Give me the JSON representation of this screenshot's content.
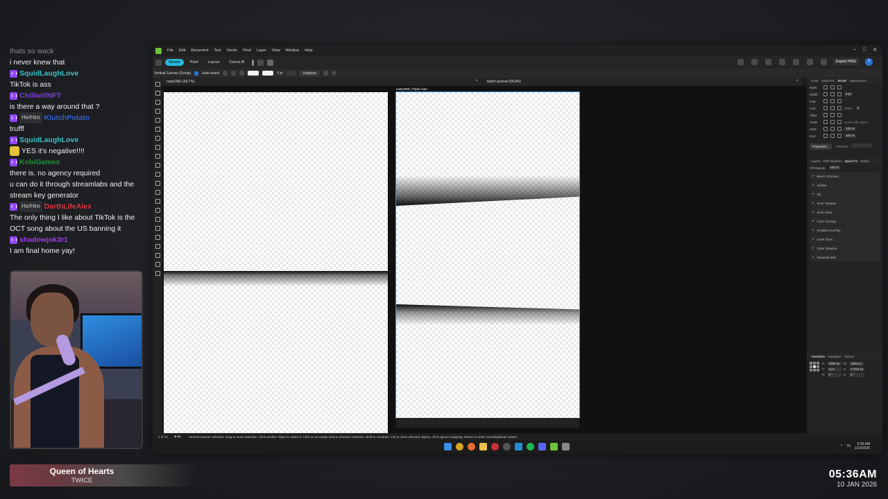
{
  "chat": {
    "messages": [
      {
        "type": "text",
        "text": "thats so wack",
        "faded": true
      },
      {
        "type": "text",
        "text": "i never knew that"
      },
      {
        "type": "user",
        "name": "SquidLaughLove",
        "color": "#3fc1c9"
      },
      {
        "type": "text",
        "text": "TikTok is ass"
      },
      {
        "type": "user",
        "name": "ChillwillNFT",
        "color": "#7b3fd6"
      },
      {
        "type": "text",
        "text": "is there a way around that ?"
      },
      {
        "type": "user",
        "pronoun": "He/Him",
        "name": "KlutchPotato",
        "color": "#2f64d6"
      },
      {
        "type": "text",
        "text": "trufff"
      },
      {
        "type": "user",
        "name": "SquidLaughLove",
        "color": "#3fc1c9"
      },
      {
        "type": "text",
        "text": "YES it's negative!!!!",
        "emote": true
      },
      {
        "type": "user",
        "name": "KobiGames",
        "color": "#2a8a3a"
      },
      {
        "type": "text",
        "text": "there is. no agency required"
      },
      {
        "type": "text",
        "text": "u can do it through streamlabs and the stream key generator"
      },
      {
        "type": "user",
        "pronoun": "He/Him",
        "name": "DarthLifeAlex",
        "color": "#e0333b"
      },
      {
        "type": "text",
        "text": "The only thing I like about TikTok is the OCT song about the US banning it"
      },
      {
        "type": "user",
        "name": "shadowjok3r1",
        "color": "#9b3fe6"
      },
      {
        "type": "text",
        "text": "I am final home yay!"
      }
    ]
  },
  "now_playing": {
    "title": "Queen of Hearts",
    "artist": "TWICE"
  },
  "clock": {
    "time": "05:36AM",
    "date": "10 JAN 2026"
  },
  "app": {
    "menu": [
      "File",
      "Edit",
      "Document",
      "Text",
      "Vector",
      "Pixel",
      "Layer",
      "View",
      "Window",
      "Help"
    ],
    "personas": [
      {
        "label": "Vector",
        "active": true
      },
      {
        "label": "Pixel",
        "active": false
      },
      {
        "label": "Layout",
        "active": false
      },
      {
        "label": "Canva AI",
        "active": false
      }
    ],
    "export_label": "Export PNG",
    "help_label": "?",
    "context": {
      "selection": "Vertical Canvas (Group)",
      "auto_select": "Auto-select",
      "stroke_value": "0 pt",
      "ungroup": "Ungroup"
    },
    "tabs": [
      {
        "label": "nuttyONE (59.7%)"
      },
      {
        "label": "twitch-portrait (58.8%)"
      }
    ],
    "artboard_label": "nuttyONE | Triple Cam",
    "status": {
      "page": "1 of 15",
      "hint": "'Vertical Canvas' selected. Drag to move selection. Click another object to select it. Click on an empty area to deselect selection. Shift to constrain. Ctrl to clone selected objects. Alt to ignore snapping. Return to enter move/duplicate values."
    },
    "tray": {
      "temp": "70",
      "time": "5:36 AM",
      "date": "1/10/2026"
    },
    "panel": {
      "top_tabs": [
        "Color",
        "Swatches",
        "Stroke",
        "Appearance"
      ],
      "active_top_tab": "Stroke",
      "stroke_rows": [
        {
          "label": "Style:"
        },
        {
          "label": "Width:",
          "value": "0 pt"
        },
        {
          "label": "Cap:"
        },
        {
          "label": "Join:",
          "extra": "Mitter:",
          "extra_value": "2"
        },
        {
          "label": "Align:"
        },
        {
          "label": "Order:",
          "extra": "Scale with object"
        },
        {
          "label": "Start:",
          "value": "100 %"
        },
        {
          "label": "End:",
          "value": "100 %"
        }
      ],
      "properties_button": "Properties...",
      "pressure_label": "Pressure",
      "layer_tabs": [
        "Layers",
        "Path Brushes",
        "Quick FX",
        "Styles"
      ],
      "active_layer_tab": "Quick FX",
      "fill_opacity_label": "Fill Opacity:",
      "fill_opacity_value": "100 %",
      "effects": [
        "Bevel / Emboss",
        "Outline",
        "3D",
        "Inner Shadow",
        "Inner Glow",
        "Color Overlay",
        "Gradient Overlay",
        "Outer Glow",
        "Outer Shadow",
        "Gaussian Blur"
      ],
      "transform_tabs": [
        "Transform",
        "Navigator",
        "History"
      ],
      "transform": {
        "x": "3090 px",
        "y": "0 px",
        "w": "1080 px",
        "h": "17324 px",
        "r": "0 °",
        "s": "0 °"
      }
    }
  }
}
